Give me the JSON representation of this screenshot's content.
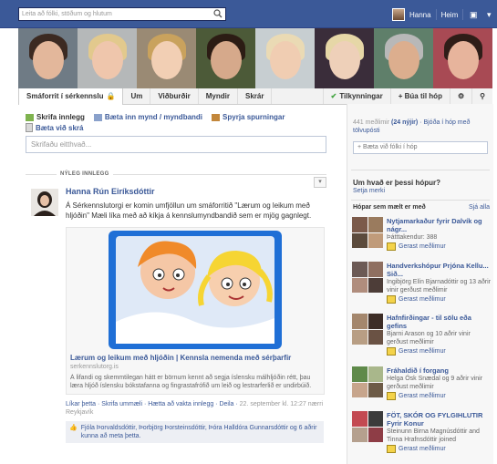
{
  "top_bar": {
    "search_placeholder": "Leita að fólki, stöðum og hlutum",
    "user_name": "Hanna",
    "home": "Heim"
  },
  "tabs": {
    "items": [
      "Smáforrit í sérkennslu",
      "Um",
      "Viðburðir",
      "Myndir",
      "Skrár"
    ],
    "notifications": "Tilkynningar",
    "create_group": "+ Búa til hóp"
  },
  "composer": {
    "write_post": "Skrifa innlegg",
    "add_photo": "Bæta inn mynd / myndbandi",
    "ask_question": "Spyrja spurningar",
    "add_file": "Bæta við skrá",
    "placeholder": "Skrifaðu eitthvað..."
  },
  "feed": {
    "recent_label": "NÝLEG INNLEGG",
    "post": {
      "author": "Hanna Rún Eiríksdóttir",
      "text": "Á Sérkennslutorgi er komin umfjöllun um smáforritið \"Lærum og leikum með hljóðin\" Mæli líka með að kíkja á kennslumyndbandið sem er mjög gagnlegt.",
      "link_title": "Lærum og leikum með hljóðin | Kennsla nemenda með sérþarfir",
      "link_domain": "serkennslutorg.is",
      "link_desc": "Á lifandi og skemmtilegan hátt er börnum kennt að segja íslensku málhljóðin rétt, þau læra hljóð íslensku bókstafanna og fingrastafrófið um leið og lestrarferlið er undirbúið. Aðferðin byggir á áratuga reynslu talmeinafræðings í",
      "meta_actions": "Líkar þetta · Skrifa ummæli · Hætta að vakta innlegg · Deila · ",
      "meta_time": "22. september kl. 12:27 nærri Reykjavík",
      "likes": "Fjóla Þorvaldsdóttir, Þorbjörg Þorsteinsdóttir, Þóra Halldóra Gunnarsdóttir og 6 aðrir kunna að meta þetta."
    }
  },
  "sidebar": {
    "members_count": "441 meðlimir",
    "members_new": "(24 nýjir)",
    "members_invite": "· Bjóða í hóp með tölvupósti",
    "add_people_placeholder": "+ Bæta við fólki í hóp",
    "about_title": "Um hvað er þessi hópur?",
    "about_link": "Setja merki",
    "suggested_title": "Hópar sem mælt er með",
    "see_all": "Sjá alla",
    "join_label": "Gerast meðlimur",
    "groups": [
      {
        "name": "Nytjamarkaður fyrir Dalvík og nágr...",
        "sub": "Þátttakendur: 388"
      },
      {
        "name": "Handverkshópur Prjóna Kellu... Sið...",
        "sub": "Ingibjörg Elín Bjarnadóttir og 13 aðrir vinir gerðust meðlimir"
      },
      {
        "name": "Hafnfirðingar - til sölu eða gefins",
        "sub": "Bjarni Arason og 10 aðrir vinir gerðust meðlimir"
      },
      {
        "name": "Fráhaldið í forgang",
        "sub": "Helga Ósk Snædal og 9 aðrir vinir gerðust meðlimir"
      },
      {
        "name": "FÖT, SKÓR OG FYLGIHLUTIR Fyrir Konur",
        "sub": "Steinunn Birna Magnúsdóttir and Tinna Hrafnsdóttir joined"
      }
    ]
  }
}
